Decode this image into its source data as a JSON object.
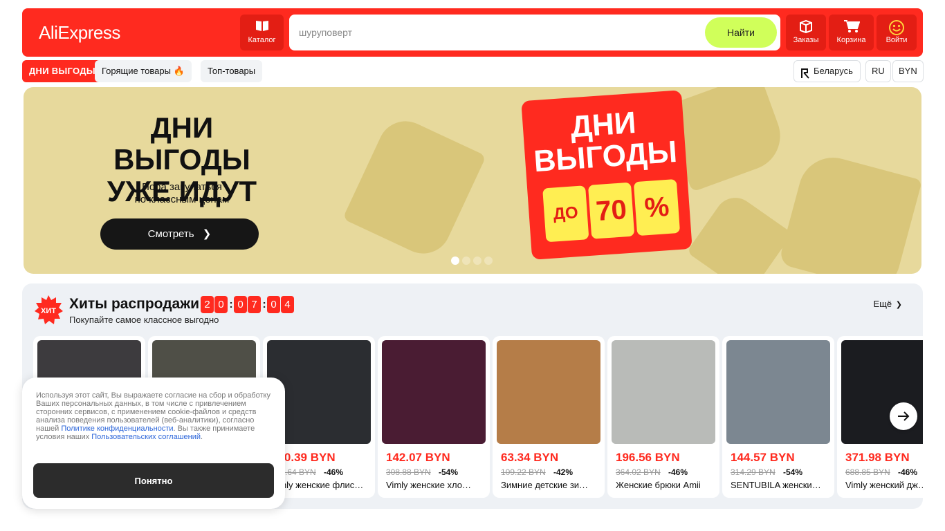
{
  "header": {
    "logo": "AliExpress",
    "catalog_label": "Каталог",
    "search_placeholder": "шуруповерт",
    "search_button": "Найти",
    "orders_label": "Заказы",
    "cart_label": "Корзина",
    "login_label": "Войти"
  },
  "subnav": {
    "promo": "ДНИ ВЫГОДЫ",
    "hot": "Горящие товары 🔥",
    "top": "Топ-товары",
    "region": "Беларусь",
    "lang": "RU",
    "currency": "BYN"
  },
  "banner": {
    "title_line1": "ДНИ ВЫГОДЫ",
    "title_line2": "УЖЕ ИДУТ",
    "sub_line1": "Пора закупаться",
    "sub_line2": "по классным ценам",
    "button": "Смотреть",
    "tag_line1": "ДНИ",
    "tag_line2": "ВЫГОДЫ",
    "tag_do": "ДО",
    "tag_num": "70",
    "tag_pct": "%",
    "slides_total": 4,
    "active_slide": 1
  },
  "hits": {
    "badge": "ХИТ",
    "title": "Хиты распродажи",
    "subtitle": "Покупайте самое классное выгодно",
    "timer": [
      "2",
      "0",
      "0",
      "7",
      "0",
      "4"
    ],
    "more": "Ещё",
    "products": [
      {
        "price": "",
        "old": "",
        "disc": "",
        "name": "",
        "img_color": "#3d3b3e"
      },
      {
        "price": "",
        "old": "",
        "disc": "",
        "name": "",
        "img_color": "#4f4f47"
      },
      {
        "price": "130.39 BYN",
        "old": "235.64 BYN",
        "disc": "-46%",
        "name": "Vimly женские флис…",
        "img_color": "#2b2d31"
      },
      {
        "price": "142.07 BYN",
        "old": "308.88 BYN",
        "disc": "-54%",
        "name": "Vimly женские хло…",
        "img_color": "#4a1c33"
      },
      {
        "price": "63.34 BYN",
        "old": "109.22 BYN",
        "disc": "-42%",
        "name": "Зимние детские зи…",
        "img_color": "#b57d48"
      },
      {
        "price": "196.56 BYN",
        "old": "364.02 BYN",
        "disc": "-46%",
        "name": "Женские брюки Amii",
        "img_color": "#b9bbb8"
      },
      {
        "price": "144.57 BYN",
        "old": "314.29 BYN",
        "disc": "-54%",
        "name": "SENTUBILA женски…",
        "img_color": "#7c8791"
      },
      {
        "price": "371.98 BYN",
        "old": "688.85 BYN",
        "disc": "-46%",
        "name": "Vimly женский дж…",
        "img_color": "#1b1c20"
      }
    ]
  },
  "cookie": {
    "text_before": "Используя этот сайт, Вы выражаете согласие на сбор и обработку Ваших персональных данных, в том числе с привлечением сторонних сервисов, с применением cookie-файлов и средств анализа поведения пользователей (веб-аналитики), согласно нашей ",
    "link1": "Политике конфиденциальности",
    "text_middle": ". Вы также принимаете условия наших ",
    "link2": "Пользовательских соглашений",
    "text_after": ".",
    "button": "Понятно"
  }
}
